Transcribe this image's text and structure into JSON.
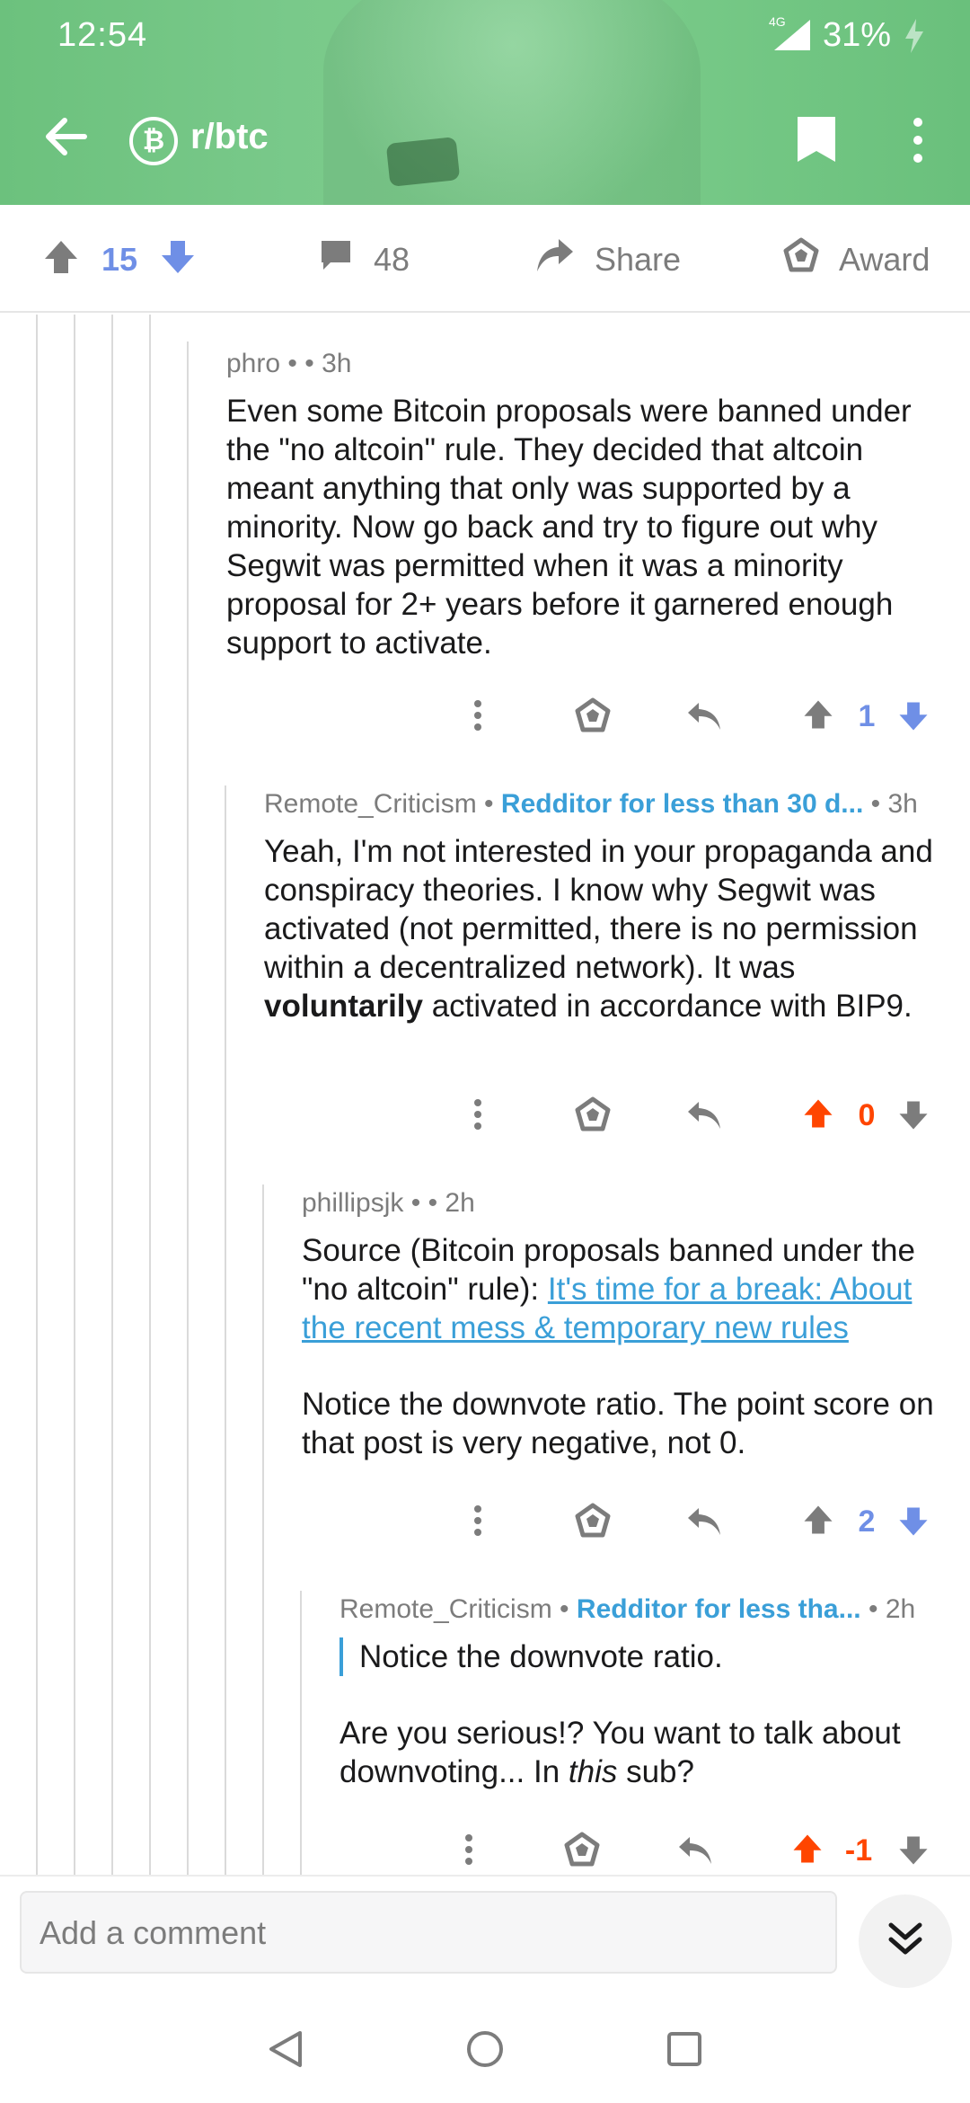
{
  "status_bar": {
    "time": "12:54",
    "network": "4G",
    "battery": "31%"
  },
  "header": {
    "subreddit": "r/btc",
    "subreddit_icon": "bitcoin-cash-icon"
  },
  "post_actions": {
    "score": "15",
    "comments_count": "48",
    "share_label": "Share",
    "award_label": "Award"
  },
  "comments": [
    {
      "author": "phro",
      "time": "3h",
      "body": "Even some Bitcoin proposals were banned under the \"no altcoin\" rule. They decided that altcoin meant anything that only was supported by a minority. Now go back and try to figure out why Segwit was permitted when it was a minority proposal for 2+ years before it garnered enough support to activate.",
      "score": "1"
    },
    {
      "author": "Remote_Criticism",
      "flair": "Redditor for less than 30 d...",
      "time": "3h",
      "body_pre": "Yeah, I'm not interested in your propaganda and conspiracy theories.  I know why Segwit was activated (not permitted, there is no permission within a decentralized network).  It was ",
      "body_bold": "voluntarily",
      "body_post": " activated in accordance with BIP9.",
      "score": "0"
    },
    {
      "author": "phillipsjk",
      "time": "2h",
      "body_pre": "Source (Bitcoin proposals banned under the \"no altcoin\" rule): ",
      "link_text": "It's time for a break: About the recent mess & temporary new rules",
      "body_post": "Notice the downvote ratio. The point score on that post is very negative, not 0.",
      "score": "2"
    },
    {
      "author": "Remote_Criticism",
      "flair": "Redditor for less tha...",
      "time": "2h",
      "quote": "Notice the downvote ratio.",
      "body_pre": "Are you serious!? You want to talk about downvoting...  In ",
      "body_italic": "this",
      "body_post": " sub?",
      "score": "-1"
    }
  ],
  "comment_input": {
    "placeholder": "Add a comment"
  },
  "colors": {
    "header_green": "#76c887",
    "upvote_orange": "#ff4500",
    "downvote_blue": "#6f8fe6",
    "icon_gray": "#7c7c7c",
    "flair_blue": "#3a9fd8"
  }
}
